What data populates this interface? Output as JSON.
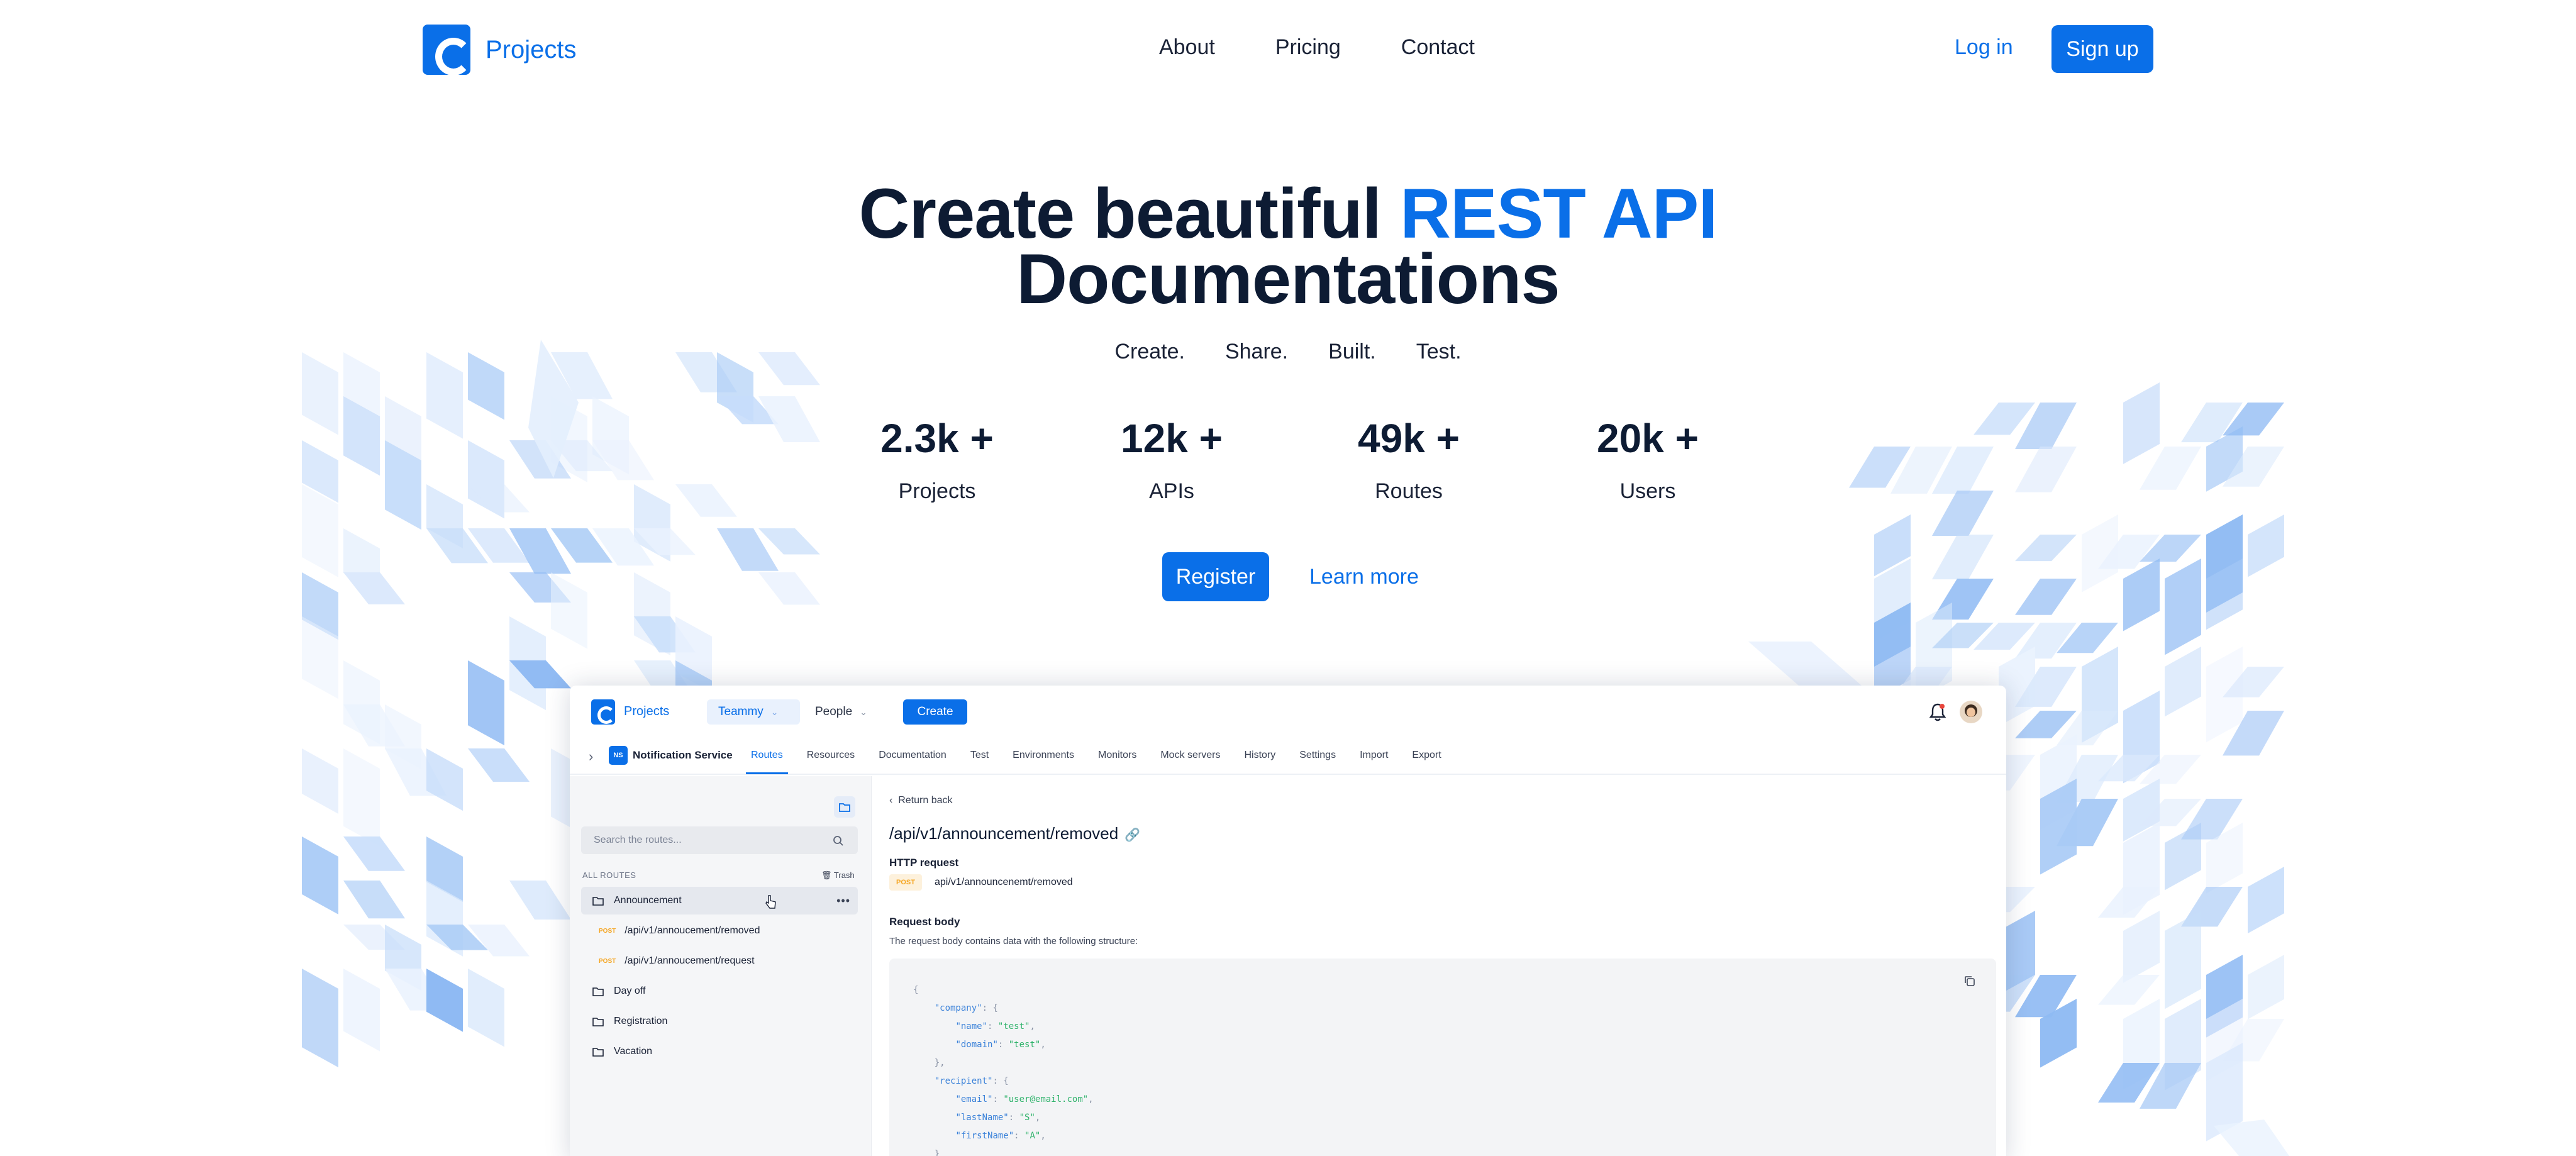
{
  "nav": {
    "brand": "Projects",
    "links": [
      "About",
      "Pricing",
      "Contact"
    ],
    "login": "Log in",
    "signup": "Sign up"
  },
  "hero": {
    "title_part1": "Create beautiful ",
    "title_accent": "REST API",
    "title_part2": "Documentations",
    "tagline": [
      "Create.",
      "Share.",
      "Built.",
      "Test."
    ],
    "stats": [
      {
        "value": "2.3k +",
        "label": "Projects"
      },
      {
        "value": "12k +",
        "label": "APIs"
      },
      {
        "value": "49k +",
        "label": "Routes"
      },
      {
        "value": "20k +",
        "label": "Users"
      }
    ],
    "register": "Register",
    "learn_more": "Learn more"
  },
  "app": {
    "brand": "Projects",
    "team": "Teammy",
    "people": "People",
    "create": "Create",
    "service_badge": "NS",
    "service_name": "Notification Service",
    "tabs": [
      "Routes",
      "Resources",
      "Documentation",
      "Test",
      "Environments",
      "Monitors",
      "Mock servers",
      "History",
      "Settings",
      "Import",
      "Export"
    ],
    "active_tab": "Routes",
    "sidebar": {
      "search_placeholder": "Search the routes...",
      "all_routes": "ALL ROUTES",
      "trash": "Trash",
      "items": [
        {
          "type": "folder",
          "label": "Announcement",
          "selected": true
        },
        {
          "type": "route",
          "method": "POST",
          "label": "/api/v1/annoucement/removed"
        },
        {
          "type": "route",
          "method": "POST",
          "label": "/api/v1/annoucement/request"
        },
        {
          "type": "folder",
          "label": "Day off"
        },
        {
          "type": "folder",
          "label": "Registration"
        },
        {
          "type": "folder",
          "label": "Vacation"
        }
      ]
    },
    "main": {
      "back": "Return back",
      "route_title": "/api/v1/announcement/removed",
      "http_request_heading": "HTTP request",
      "http_method": "POST",
      "http_path": "api/v1/announcenemt/removed",
      "request_body_heading": "Request body",
      "request_body_desc": "The request body contains data with the following structure:",
      "code": [
        {
          "indent": 0,
          "text": "{"
        },
        {
          "indent": 1,
          "key": "\"company\"",
          "rest": ": {"
        },
        {
          "indent": 2,
          "key": "\"name\"",
          "sep": ": ",
          "val": "\"test\"",
          "tail": ","
        },
        {
          "indent": 2,
          "key": "\"domain\"",
          "sep": ": ",
          "val": "\"test\"",
          "tail": ","
        },
        {
          "indent": 1,
          "text": "},"
        },
        {
          "indent": 1,
          "key": "\"recipient\"",
          "rest": ": {"
        },
        {
          "indent": 2,
          "key": "\"email\"",
          "sep": ": ",
          "val": "\"user@email.com\"",
          "tail": ","
        },
        {
          "indent": 2,
          "key": "\"lastName\"",
          "sep": ": ",
          "val": "\"S\"",
          "tail": ","
        },
        {
          "indent": 2,
          "key": "\"firstName\"",
          "sep": ": ",
          "val": "\"A\"",
          "tail": ","
        },
        {
          "indent": 1,
          "text": "}"
        }
      ]
    }
  },
  "colors": {
    "accent": "#0a6fe8",
    "text_dark": "#0d1b33",
    "method_post": "#f5a623",
    "code_string": "#2fb36b"
  }
}
